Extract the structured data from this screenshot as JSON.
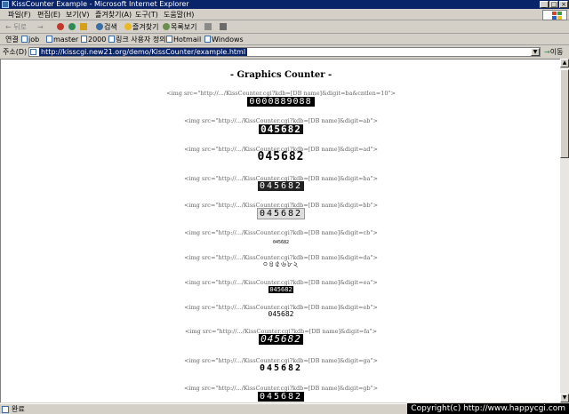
{
  "window": {
    "title": "KissCounter Example - Microsoft Internet Explorer"
  },
  "window_buttons": {
    "minimize": "_",
    "maximize": "□",
    "close": "×"
  },
  "menu": [
    {
      "label": "파일(F)"
    },
    {
      "label": "편집(E)"
    },
    {
      "label": "보기(V)"
    },
    {
      "label": "즐겨찾기(A)"
    },
    {
      "label": "도구(T)"
    },
    {
      "label": "도움말(H)"
    }
  ],
  "toolbar": {
    "back": "← 뒤로",
    "forward": "→",
    "search": "검색",
    "favorites": "즐겨찾기",
    "history": "목록보기"
  },
  "links": {
    "label": "연결",
    "items": [
      {
        "label": "job"
      },
      {
        "label": "master"
      },
      {
        "label": "2000"
      },
      {
        "label": "링크 사용자 정의"
      },
      {
        "label": "Hotmail"
      },
      {
        "label": "Windows"
      }
    ]
  },
  "address": {
    "label": "주소(D)",
    "url": "http://kisscgi.new21.org/demo/KissCounter/example.html",
    "go": "이동"
  },
  "page": {
    "title": "- Graphics Counter -",
    "examples": [
      {
        "code": "<img src=\"http://.../KissCounter.cgi?kdb=[DB name]&digit=ba&cntlen=10\">",
        "counter": "0000889088",
        "style": "s-ba"
      },
      {
        "code": "<img src=\"http://.../KissCounter.cgi?kdb=[DB name]&digit=ab\">",
        "counter": "045682",
        "style": "s-ab"
      },
      {
        "code": "<img src=\"http://.../KissCounter.cgi?kdb=[DB name]&digit=ad\">",
        "counter": "045682",
        "style": "s-ad"
      },
      {
        "code": "<img src=\"http://.../KissCounter.cgi?kdb=[DB name]&digit=ba\">",
        "counter": "045682",
        "style": "s-ba2"
      },
      {
        "code": "<img src=\"http://.../KissCounter.cgi?kdb=[DB name]&digit=bb\">",
        "counter": "045682",
        "style": "s-bb"
      },
      {
        "code": "<img src=\"http://.../KissCounter.cgi?kdb=[DB name]&digit=cb\">",
        "counter": "045682",
        "style": "s-cb"
      },
      {
        "code": "<img src=\"http://.../KissCounter.cgi?kdb=[DB name]&digit=da\">",
        "counter": "০৪৫৬৮২",
        "style": "s-da"
      },
      {
        "code": "<img src=\"http://.../KissCounter.cgi?kdb=[DB name]&digit=ea\">",
        "counter": "045682",
        "style": "s-ea"
      },
      {
        "code": "<img src=\"http://.../KissCounter.cgi?kdb=[DB name]&digit=eb\">",
        "counter": "045682",
        "style": "s-eb"
      },
      {
        "code": "<img src=\"http://.../KissCounter.cgi?kdb=[DB name]&digit=fa\">",
        "counter": "045682",
        "style": "s-fa"
      },
      {
        "code": "<img src=\"http://.../KissCounter.cgi?kdb=[DB name]&digit=ga\">",
        "counter": "045682",
        "style": "s-ga"
      },
      {
        "code": "<img src=\"http://.../KissCounter.cgi?kdb=[DB name]&digit=gb\">",
        "counter": "045682",
        "style": "s-gb"
      }
    ]
  },
  "status": {
    "text": "완료"
  },
  "watermark": "Copyright(c) http://www.happycgi.com"
}
